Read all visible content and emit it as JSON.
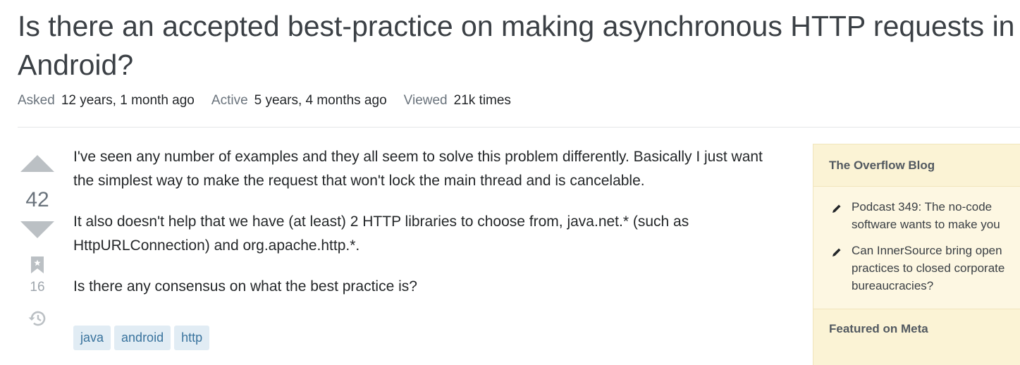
{
  "question": {
    "title": "Is there an accepted best-practice on making asynchronous HTTP requests in Android?",
    "asked_label": "Asked",
    "asked_value": "12 years, 1 month ago",
    "active_label": "Active",
    "active_value": "5 years, 4 months ago",
    "viewed_label": "Viewed",
    "viewed_value": "21k times",
    "vote_count": "42",
    "bookmark_count": "16",
    "body": [
      "I've seen any number of examples and they all seem to solve this problem differently. Basically I just want the simplest way to make the request that won't lock the main thread and is cancelable.",
      "It also doesn't help that we have (at least) 2 HTTP libraries to choose from, java.net.* (such as HttpURLConnection) and org.apache.http.*.",
      "Is there any consensus on what the best practice is?"
    ],
    "tags": [
      "java",
      "android",
      "http"
    ]
  },
  "sidebar": {
    "blog_header": "The Overflow Blog",
    "blog_items": [
      "Podcast 349: The no-code software wants to make you",
      "Can InnerSource bring open practices to closed corporate bureaucracies?"
    ],
    "meta_header": "Featured on Meta"
  },
  "icons": {
    "vote_up": "upvote-arrow-icon",
    "vote_down": "downvote-arrow-icon",
    "bookmark": "bookmark-icon",
    "history": "history-icon",
    "pencil": "pencil-icon"
  },
  "colors": {
    "tag_bg": "#e1ecf4",
    "tag_text": "#39739d",
    "sidebar_bg": "#fbf3d5",
    "arrow": "#bbc0c4"
  }
}
